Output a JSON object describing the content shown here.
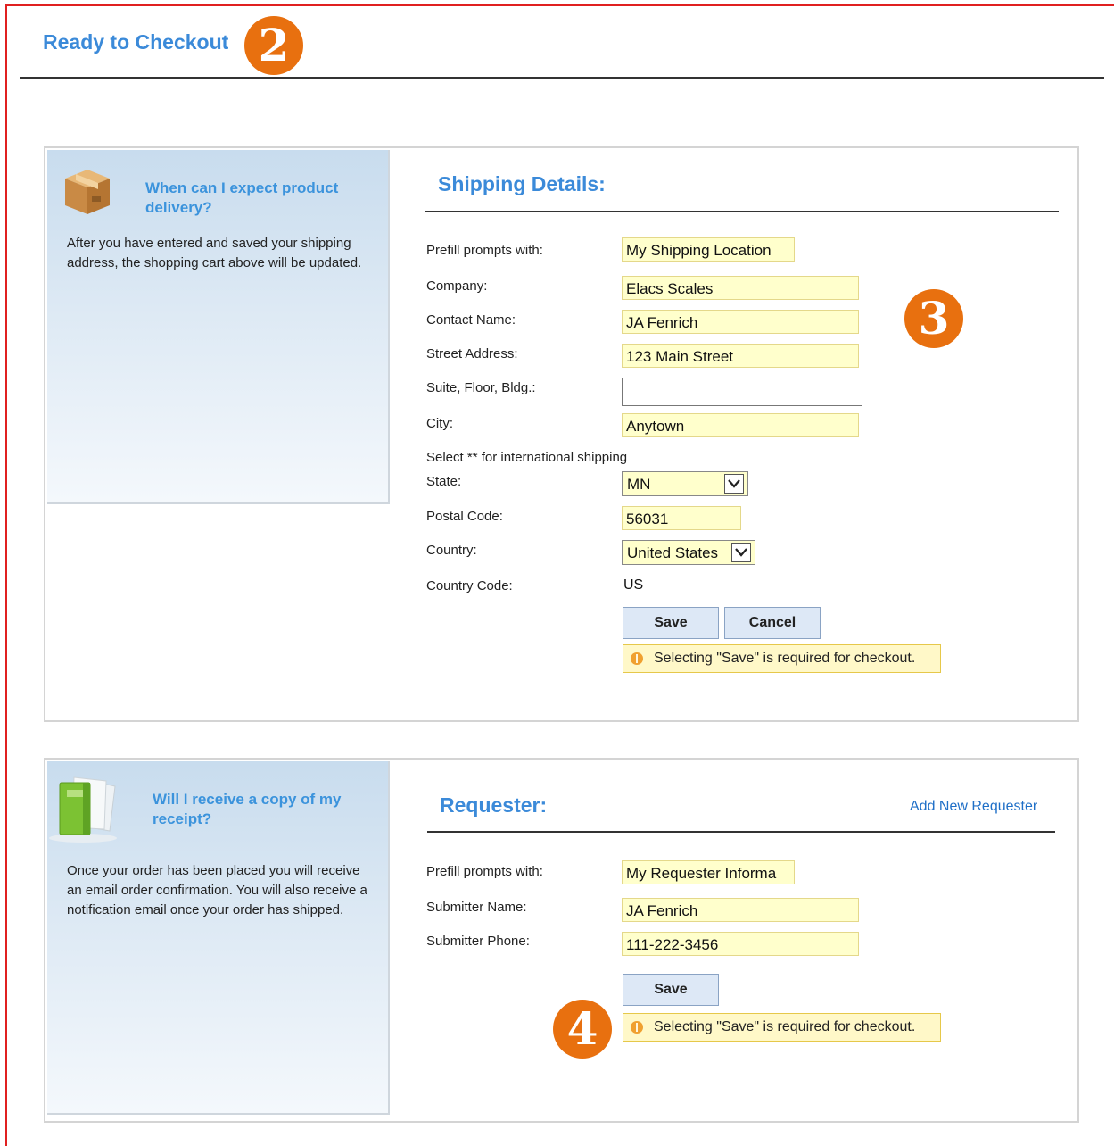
{
  "page": {
    "title": "Ready to Checkout",
    "step_badges": [
      "2",
      "3",
      "4"
    ]
  },
  "shipping": {
    "help_title": "When can I expect product delivery?",
    "help_text": "After you have entered and saved your shipping address, the shopping cart above will be updated.",
    "section_title": "Shipping Details:",
    "fields": {
      "prefill_label": "Prefill prompts with:",
      "prefill_value": "My Shipping Location",
      "company_label": "Company:",
      "company_value": "Elacs Scales",
      "contact_label": "Contact Name:",
      "contact_value": "JA Fenrich",
      "street_label": "Street Address:",
      "street_value": "123 Main Street",
      "suite_label": "Suite, Floor, Bldg.:",
      "suite_value": "",
      "city_label": "City:",
      "city_value": "Anytown",
      "intl_note": "Select ** for international shipping",
      "state_label": "State:",
      "state_value": "MN",
      "postal_label": "Postal Code:",
      "postal_value": "56031",
      "country_label": "Country:",
      "country_value": "United States",
      "country_code_label": "Country Code:",
      "country_code_value": "US"
    },
    "save_label": "Save",
    "cancel_label": "Cancel",
    "notice": "Selecting \"Save\" is required for checkout."
  },
  "requester": {
    "help_title": "Will I receive a copy of my receipt?",
    "help_text": "Once your order has been placed you will receive an email order confirmation. You will also receive a notification email once your order has shipped.",
    "section_title": "Requester:",
    "add_link": "Add New Requester",
    "fields": {
      "prefill_label": "Prefill prompts with:",
      "prefill_value": "My Requester Informa",
      "name_label": "Submitter Name:",
      "name_value": "JA Fenrich",
      "phone_label": "Submitter Phone:",
      "phone_value": "111-222-3456"
    },
    "save_label": "Save",
    "notice": "Selecting \"Save\" is required for checkout."
  },
  "colors": {
    "accent_blue": "#3b8ad9",
    "badge_orange": "#e8700f",
    "input_fill": "#ffffcc",
    "notice_fill": "#fff8c8"
  },
  "icons": [
    "package-box-icon",
    "receipt-document-icon",
    "info-warning-icon",
    "chevron-down-icon"
  ]
}
